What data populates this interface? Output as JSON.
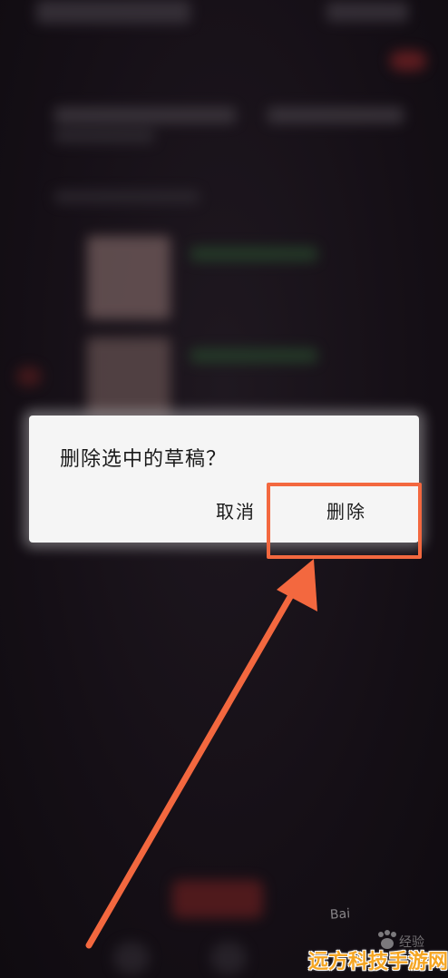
{
  "dialog": {
    "message": "删除选中的草稿？",
    "cancel_label": "取消",
    "delete_label": "删除"
  },
  "annotation": {
    "highlight_color": "#f3683f",
    "arrow_color": "#f3683f"
  },
  "watermarks": {
    "baidu_text": "Bai",
    "jingyan_text": "经验",
    "site_text": "远方科技手游网",
    "site_color": "#f5a623"
  }
}
